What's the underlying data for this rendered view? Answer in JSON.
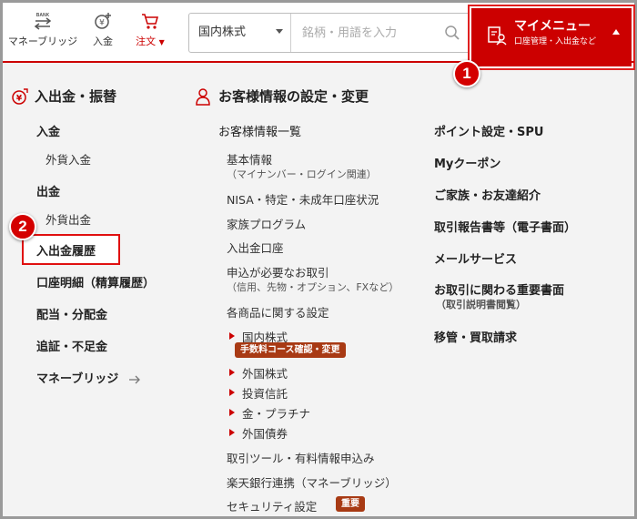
{
  "header": {
    "nav": [
      {
        "label": "マネーブリッジ",
        "icon": "bank-transfer-icon"
      },
      {
        "label": "入金",
        "icon": "yen-deposit-icon"
      },
      {
        "label": "注文",
        "icon": "cart-icon",
        "caret": "▼"
      }
    ],
    "search": {
      "market_selected": "国内株式",
      "placeholder": "銘柄・用語を入力",
      "icon": "search-icon"
    },
    "my_menu": {
      "title": "マイメニュー",
      "subtitle": "口座管理・入出金など",
      "icon": "account-manage-icon"
    }
  },
  "badges": {
    "one": "1",
    "two": "2"
  },
  "left_section": {
    "title": "入出金・振替",
    "icon": "yen-transfer-icon",
    "items": [
      {
        "label": "入金"
      },
      {
        "label": "外貨入金"
      },
      {
        "label": "出金"
      },
      {
        "label": "外貨出金"
      },
      {
        "label": "入出金履歴"
      },
      {
        "label": "口座明細（精算履歴）"
      },
      {
        "label": "配当・分配金"
      },
      {
        "label": "追証・不足金"
      },
      {
        "label": "マネーブリッジ"
      }
    ]
  },
  "right_section": {
    "title": "お客様情報の設定・変更",
    "icon": "person-icon",
    "col1": {
      "heading": "お客様情報一覧",
      "basic_info": "基本情報",
      "basic_info_sub": "（マイナンバー・ログイン関連）",
      "nisa": "NISA・特定・未成年口座状況",
      "family": "家族プログラム",
      "bank_account": "入出金口座",
      "apply_trade": "申込が必要なお取引",
      "apply_trade_sub": "（信用、先物・オプション、FXなど）",
      "product_settings": "各商品に関する設定",
      "domestic": "国内株式",
      "domestic_tag": "手数料コース確認・変更",
      "foreign": "外国株式",
      "fund": "投資信託",
      "gold": "金・プラチナ",
      "foreign_bond": "外国債券",
      "tools": "取引ツール・有料情報申込み",
      "rakuten_bank": "楽天銀行連携（マネーブリッジ）",
      "security": "セキュリティ設定",
      "security_tag": "重要"
    },
    "col2": {
      "points": "ポイント設定・SPU",
      "coupon": "Myクーポン",
      "family_friends": "ご家族・お友達紹介",
      "reports": "取引報告書等（電子書面）",
      "mail": "メールサービス",
      "important_docs": "お取引に関わる重要書面",
      "important_docs_sub": "（取引説明書閲覧）",
      "transfer": "移管・買取請求"
    }
  },
  "colors": {
    "accent": "#cc0000",
    "tag": "#a83a14",
    "background": "#f3f3f3"
  }
}
